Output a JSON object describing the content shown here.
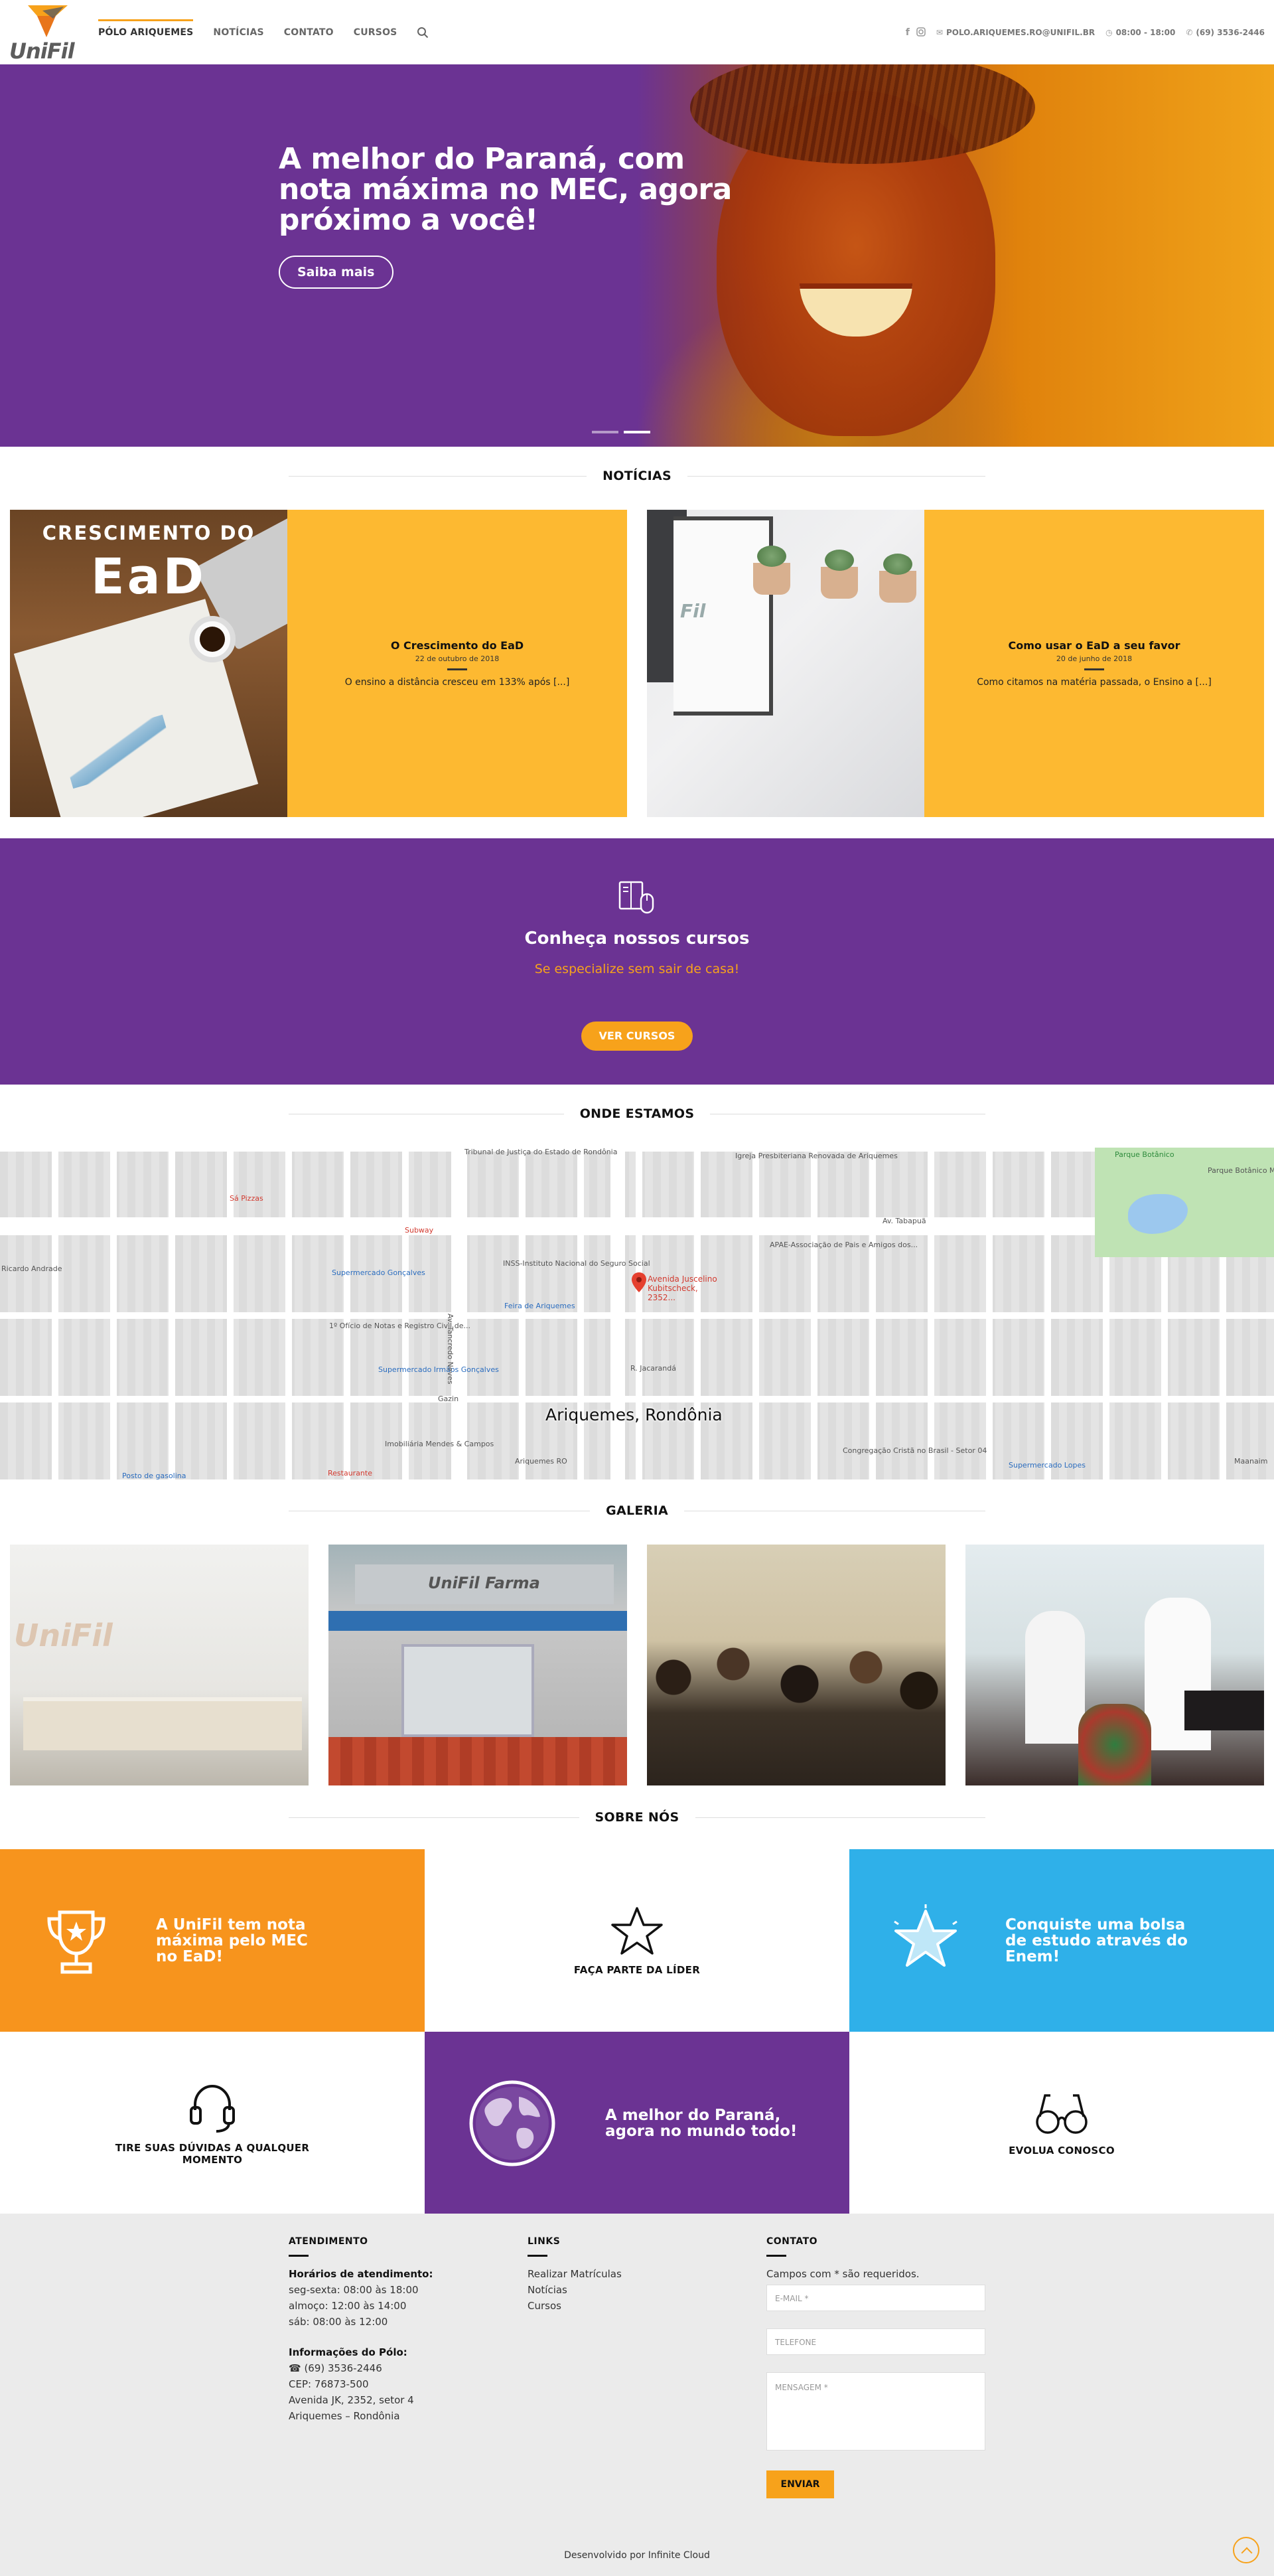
{
  "brand": {
    "name": "UniFil",
    "accent": "#f7a21b",
    "purple": "#6b3393",
    "yellow": "#fdb931",
    "blue": "#2fb0e9"
  },
  "nav": {
    "items": [
      "PÓLO ARIQUEMES",
      "NOTÍCIAS",
      "CONTATO",
      "CURSOS"
    ],
    "active_index": 0,
    "search_icon": "search-icon"
  },
  "topbar": {
    "social": [
      "facebook-icon",
      "instagram-icon"
    ],
    "email": "POLO.ARIQUEMES.RO@UNIFIL.BR",
    "hours": "08:00 - 18:00",
    "phone": "(69) 3536-2446"
  },
  "hero": {
    "title": "A melhor do Paraná, com nota máxima no MEC, agora próximo a você!",
    "button": "Saiba mais",
    "slides": 2,
    "active_slide": 1
  },
  "news": {
    "title": "NOTÍCIAS",
    "items": [
      {
        "image_caption_top": "CRESCIMENTO DO",
        "image_caption_big": "EaD",
        "title": "O Crescimento do EaD",
        "date": "22 de outubro de 2018",
        "excerpt": "O ensino a distância cresceu em 133% após [...]"
      },
      {
        "title": "Como usar o EaD a seu favor",
        "date": "20 de junho de 2018",
        "excerpt": "Como citamos na matéria passada, o Ensino a [...]"
      }
    ]
  },
  "courses": {
    "title": "Conheça nossos cursos",
    "subtitle": "Se especialize sem sair de casa!",
    "button": "VER CURSOS"
  },
  "map": {
    "title": "ONDE ESTAMOS",
    "center_label": "Ariquemes, Rondônia",
    "pin_label": "Avenida Juscelino Kubitscheck, 2352...",
    "labels": [
      "Tribunal de Justiça do Estado de Rondônia",
      "Igreja Presbiteriana Renovada de Ariquemes",
      "Parque Botânico",
      "Parque Botânico Municipal de Ariquemes",
      "Sá Pizzas",
      "Subway",
      "Supermercado Gonçalves",
      "INSS-Instituto Nacional do Seguro Social",
      "APAE-Associação de Pais e Amigos dos...",
      "Feira de Ariquemes",
      "1º Ofício de Notas e Registro Civil de...",
      "Supermercado Irmãos Gonçalves",
      "Gazin",
      "Imobiliária Mendes & Campos",
      "Restaurante",
      "Ariquemes RO",
      "Congregação Cristã no Brasil - Setor 04",
      "Supermercado Lopes",
      "Av. Tabapuã",
      "Av. Tancredo Neves",
      "R. Jacarandá",
      "Posto de gasolina",
      "Maanaim",
      "Ricardo Andrade"
    ]
  },
  "gallery": {
    "title": "GALERIA",
    "items": [
      {
        "logo_text": "UniFil"
      },
      {
        "sign_text": "UniFil Farma"
      },
      {},
      {}
    ]
  },
  "about": {
    "title": "SOBRE NÓS",
    "tiles": [
      {
        "text": "A UniFil tem nota máxima pelo MEC no EaD!",
        "icon": "trophy-icon",
        "bg": "#f7941d"
      },
      {
        "text": "FAÇA PARTE DA LÍDER",
        "icon": "star-icon",
        "bg": "#ffffff"
      },
      {
        "text": "Conquiste uma bolsa de estudo através do Enem!",
        "icon": "star-badge-icon",
        "bg": "#2fb0e9"
      },
      {
        "text": "TIRE SUAS DÚVIDAS A QUALQUER MOMENTO",
        "icon": "headset-icon",
        "bg": "#ffffff"
      },
      {
        "text": "A melhor do Paraná, agora no mundo todo!",
        "icon": "globe-icon",
        "bg": "#6b3393"
      },
      {
        "text": "EVOLUA CONOSCO",
        "icon": "glasses-icon",
        "bg": "#ffffff"
      }
    ]
  },
  "footer": {
    "atendimento": {
      "title": "ATENDIMENTO",
      "hours_title": "Horários de atendimento:",
      "hours": [
        "seg-sexta: 08:00 às 18:00",
        "almoço: 12:00 às 14:00",
        "sáb: 08:00 às 12:00"
      ],
      "info_title": "Informações do Pólo:",
      "info": [
        "☎ (69) 3536-2446",
        "CEP: 76873-500",
        "Avenida JK, 2352, setor 4",
        "Ariquemes – Rondônia"
      ]
    },
    "links": {
      "title": "LINKS",
      "items": [
        "Realizar Matrículas",
        "Notícias",
        "Cursos"
      ]
    },
    "contato": {
      "title": "CONTATO",
      "note": "Campos com * são requeridos.",
      "email_placeholder": "E-MAIL *",
      "phone_placeholder": "TELEFONE",
      "message_placeholder": "MENSAGEM *",
      "button": "ENVIAR"
    },
    "credit": "Desenvolvido por Infinite Cloud"
  }
}
